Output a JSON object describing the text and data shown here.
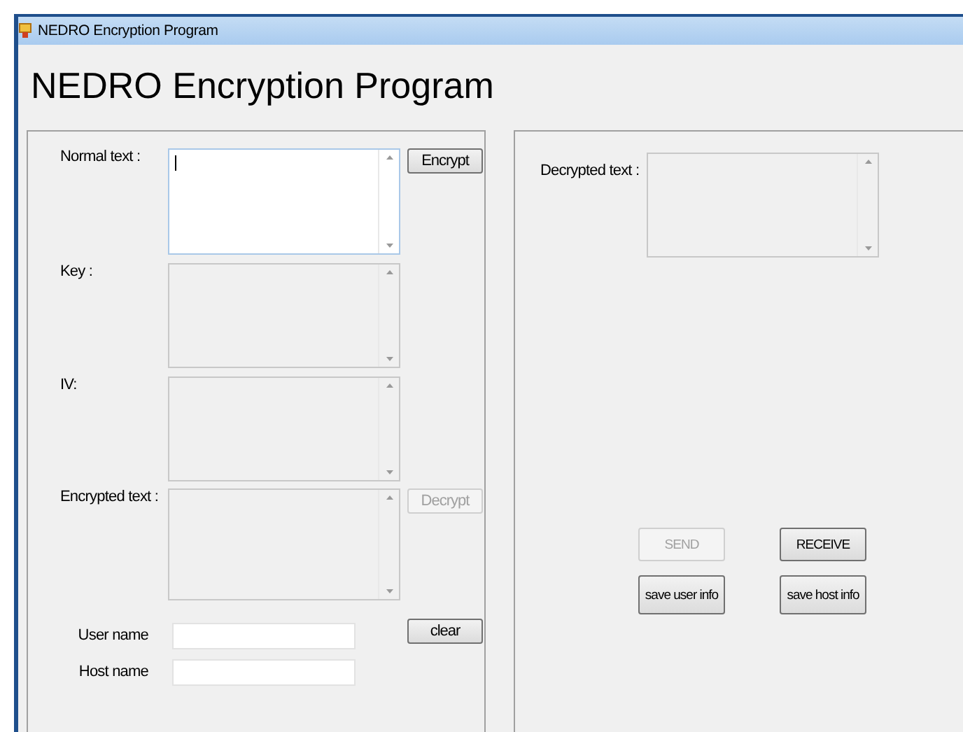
{
  "window": {
    "title": "NEDRO Encryption Program"
  },
  "heading": "NEDRO Encryption Program",
  "encrypt_panel": {
    "text_areas": [
      {
        "label": "Normal text :",
        "disabled": false,
        "button": {
          "label": "Encrypt",
          "disabled": false
        }
      },
      {
        "label": "Key :",
        "disabled": true
      },
      {
        "label": "IV:",
        "disabled": true
      },
      {
        "label": "Encrypted text :",
        "disabled": true,
        "button": {
          "label": "Decrypt",
          "disabled": true
        }
      }
    ],
    "name_fields": [
      {
        "label": "User name"
      },
      {
        "label": "Host name"
      }
    ],
    "clear_button": {
      "label": "clear",
      "disabled": false
    }
  },
  "decrypt_panel": {
    "text_area": {
      "label": "Decrypted text :",
      "disabled": true
    },
    "buttons": [
      {
        "label": "SEND",
        "disabled": true
      },
      {
        "label": "RECEIVE",
        "disabled": false
      },
      {
        "label": "save user info",
        "disabled": false
      },
      {
        "label": "save host info",
        "disabled": false
      }
    ]
  }
}
